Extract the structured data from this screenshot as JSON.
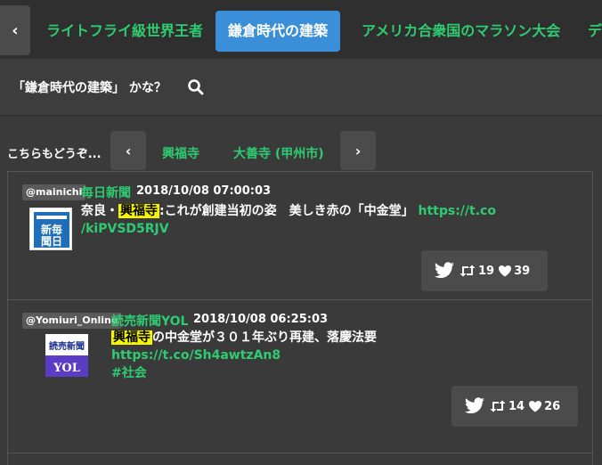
{
  "topbar": {
    "prev_icon": "chevron-left-icon",
    "tabs": [
      {
        "label": "ライトフライ級世界王者"
      },
      {
        "label": "鎌倉時代の建築"
      },
      {
        "label": "アメリカ合衆国のマラソン大会"
      },
      {
        "label": "デ"
      }
    ]
  },
  "search": {
    "query": "「鎌倉時代の建築」 かな？",
    "icon": "search-icon"
  },
  "related": {
    "label": "こちらもどうぞ...",
    "items": [
      {
        "label": "興福寺"
      },
      {
        "label": "大善寺 (甲州市)"
      }
    ]
  },
  "tweets": [
    {
      "handle": "@mainichi",
      "source": "毎日新聞",
      "datetime": "2018/10/08 07:00:03",
      "body_pre": "奈良・",
      "highlight": "興福寺",
      "body_post": ":これが創建当初の姿　美しき赤の「中金堂」",
      "link_part1": "https://t.co",
      "link_part2": "/kiPVSD5RJV",
      "retweets": "19",
      "likes": "39",
      "logo_text": "新毎聞日"
    },
    {
      "handle": "@Yomiuri_Online",
      "source": "読売新聞YOL",
      "datetime": "2018/10/08 06:25:03",
      "highlight": "興福寺",
      "body_post": "の中金堂が３０１年ぶり再建、落慶法要",
      "link": "https://t.co/Sh4awtzAn8",
      "hashtag": "#社会",
      "retweets": "14",
      "likes": "26",
      "logo_top": "読売新聞",
      "logo_bottom": "YOL"
    }
  ],
  "colors": {
    "accent_green": "#2ecc71",
    "active_tab": "#3a8fd8",
    "highlight": "#f7f500",
    "background": "#3a3a3a"
  }
}
